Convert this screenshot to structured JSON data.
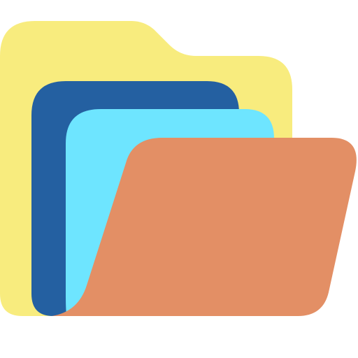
{
  "icon": {
    "name": "open-folder-icon",
    "colors": {
      "folder_back": "#F8EC7E",
      "sheet_dark": "#2460A1",
      "sheet_light": "#6EE5FF",
      "folder_front": "#E38F65"
    }
  }
}
